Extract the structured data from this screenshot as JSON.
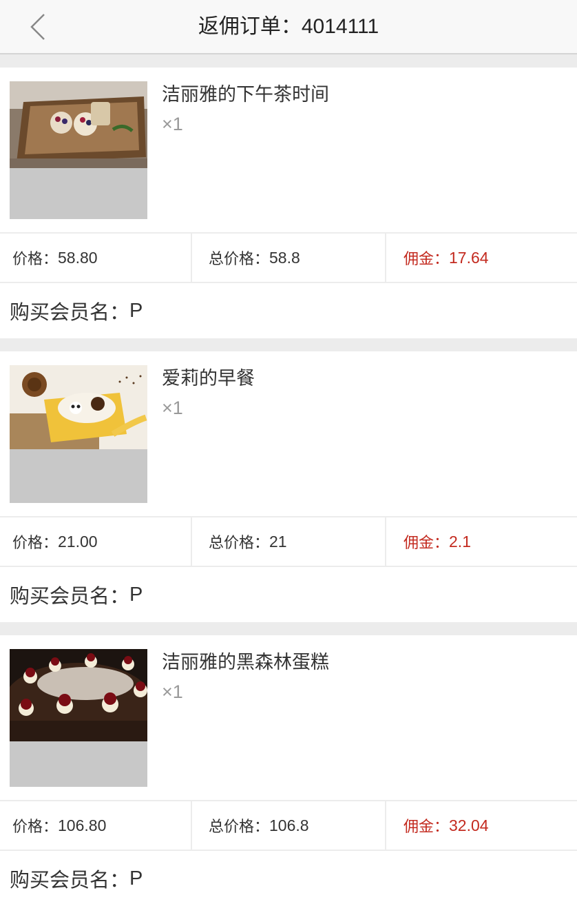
{
  "header": {
    "title_prefix": "返佣订单：",
    "order_no": "4014111"
  },
  "labels": {
    "price": "价格：",
    "total": "总价格：",
    "commission": "佣金：",
    "member": "购买会员名："
  },
  "colors": {
    "commission": "#c32a1f",
    "section_gap": "#ececec",
    "header_bg": "#f8f8f8"
  },
  "orders": [
    {
      "name": "洁丽雅的下午茶时间",
      "qty": "×1",
      "price": "58.80",
      "total": "58.8",
      "commission": "17.64",
      "member": "P",
      "image": "afternoon-tea-tray"
    },
    {
      "name": "爱莉的早餐",
      "qty": "×1",
      "price": "21.00",
      "total": "21",
      "commission": "2.1",
      "member": "P",
      "image": "breakfast-bowl"
    },
    {
      "name": "洁丽雅的黑森林蛋糕",
      "qty": "×1",
      "price": "106.80",
      "total": "106.8",
      "commission": "32.04",
      "member": "P",
      "image": "black-forest-cake"
    }
  ]
}
